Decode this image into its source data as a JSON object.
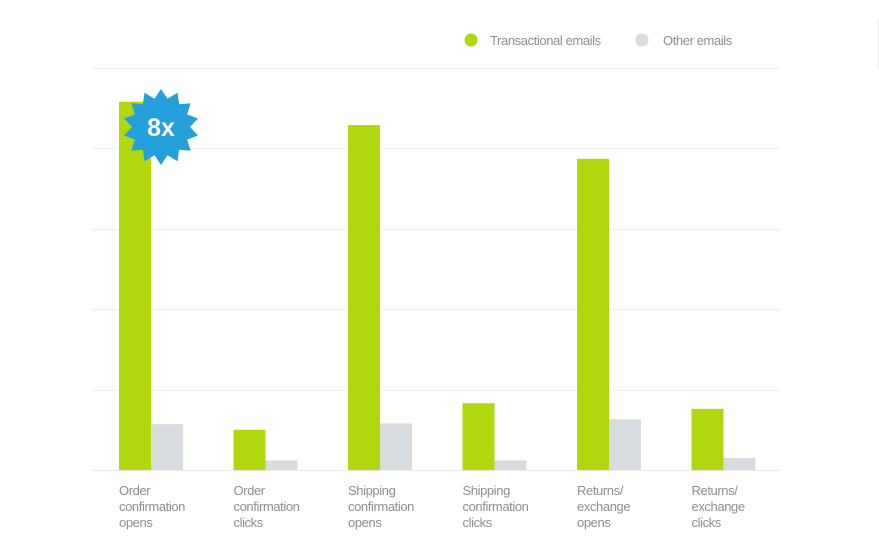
{
  "chart_data": {
    "type": "bar",
    "title": "",
    "xlabel": "",
    "ylabel": "",
    "ylim": [
      0,
      5
    ],
    "grid": true,
    "y_ticks_labeled": false,
    "legend_position": "top-right",
    "categories": [
      [
        "Order",
        "confirmation",
        "opens"
      ],
      [
        "Order",
        "confirmation",
        "clicks"
      ],
      [
        "Shipping",
        "confirmation",
        "opens"
      ],
      [
        "Shipping",
        "confirmation",
        "clicks"
      ],
      [
        "Returns/",
        "exchange",
        "opens"
      ],
      [
        "Returns/",
        "exchange",
        "clicks"
      ]
    ],
    "series": [
      {
        "name": "Transactional emails",
        "color": "#b0d80c",
        "values": [
          4.58,
          0.5,
          4.29,
          0.83,
          3.87,
          0.76
        ]
      },
      {
        "name": "Other emails",
        "color": "#d9dcdf",
        "values": [
          0.57,
          0.12,
          0.58,
          0.12,
          0.63,
          0.15
        ]
      }
    ],
    "annotations": [
      {
        "text": "8x",
        "category_index": 0,
        "series_index": 0,
        "shape": "starburst-badge",
        "color": "#24a0da"
      }
    ]
  }
}
